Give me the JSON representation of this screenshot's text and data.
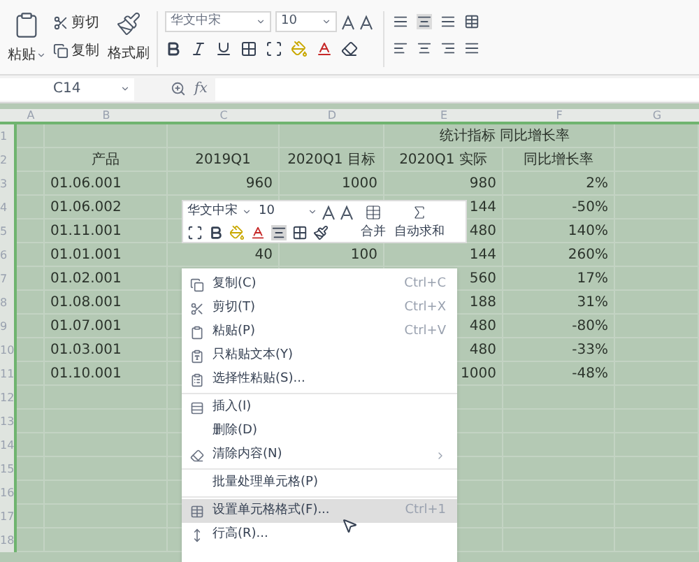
{
  "ribbon": {
    "paste": "粘贴",
    "cut": "剪切",
    "copy": "复制",
    "format_painter": "格式刷",
    "font": {
      "name": "华文中宋",
      "size": "10"
    }
  },
  "formula_bar": {
    "name_box": "C14",
    "function_label": "fx"
  },
  "sheet": {
    "columns": [
      "A",
      "B",
      "C",
      "D",
      "E",
      "F",
      "G"
    ],
    "rows": [
      {
        "number": "1",
        "kind": "title",
        "cells": [
          "",
          "",
          "",
          "",
          "统计指标 同比增长率",
          "",
          ""
        ]
      },
      {
        "number": "2",
        "kind": "header",
        "cells": [
          "",
          "产品",
          "2019Q1",
          "2020Q1 目标",
          "2020Q1 实际",
          "同比增长率",
          ""
        ]
      },
      {
        "number": "3",
        "kind": "data",
        "cells": [
          "",
          "01.06.001",
          "960",
          "1000",
          "980",
          "2%",
          ""
        ]
      },
      {
        "number": "4",
        "kind": "data",
        "cells": [
          "",
          "01.06.002",
          "",
          "",
          "144",
          "-50%",
          ""
        ]
      },
      {
        "number": "5",
        "kind": "data",
        "cells": [
          "",
          "01.11.001",
          "",
          "",
          "480",
          "140%",
          ""
        ]
      },
      {
        "number": "6",
        "kind": "data",
        "cells": [
          "",
          "01.01.001",
          "40",
          "100",
          "144",
          "260%",
          ""
        ]
      },
      {
        "number": "7",
        "kind": "data",
        "cells": [
          "",
          "01.02.001",
          "",
          "",
          "560",
          "17%",
          ""
        ]
      },
      {
        "number": "8",
        "kind": "data",
        "cells": [
          "",
          "01.08.001",
          "",
          "",
          "188",
          "31%",
          ""
        ]
      },
      {
        "number": "9",
        "kind": "data",
        "cells": [
          "",
          "01.07.001",
          "",
          "",
          "480",
          "-80%",
          ""
        ]
      },
      {
        "number": "10",
        "kind": "data",
        "cells": [
          "",
          "01.03.001",
          "",
          "",
          "480",
          "-33%",
          ""
        ]
      },
      {
        "number": "11",
        "kind": "data",
        "cells": [
          "",
          "01.10.001",
          "",
          "",
          "1000",
          "-48%",
          ""
        ]
      },
      {
        "number": "12",
        "kind": "data",
        "cells": []
      },
      {
        "number": "13",
        "kind": "data",
        "cells": []
      },
      {
        "number": "14",
        "kind": "data",
        "cells": []
      },
      {
        "number": "15",
        "kind": "data",
        "cells": []
      },
      {
        "number": "16",
        "kind": "data",
        "cells": []
      },
      {
        "number": "17",
        "kind": "data",
        "cells": []
      },
      {
        "number": "18",
        "kind": "data",
        "cells": []
      }
    ]
  },
  "mini_toolbar": {
    "font": "华文中宋",
    "size": "10",
    "merge": "合并",
    "autosum": "自动求和"
  },
  "context_menu": [
    {
      "kind": "copy",
      "label": "复制(C)",
      "shortcut": "Ctrl+C",
      "submenu": false,
      "selected": false
    },
    {
      "kind": "cut",
      "label": "剪切(T)",
      "shortcut": "Ctrl+X",
      "submenu": false,
      "selected": false
    },
    {
      "kind": "paste",
      "label": "粘贴(P)",
      "shortcut": "Ctrl+V",
      "submenu": false,
      "selected": false
    },
    {
      "kind": "pastetext",
      "label": "只粘贴文本(Y)",
      "submenu": false,
      "selected": false
    },
    {
      "kind": "pastespecial",
      "label": "选择性粘贴(S)...",
      "submenu": false,
      "selected": false
    },
    {
      "kind": "separator"
    },
    {
      "kind": "insert",
      "label": "插入(I)",
      "submenu": false,
      "selected": false
    },
    {
      "kind": "plain",
      "label": "删除(D)",
      "submenu": false,
      "selected": false
    },
    {
      "kind": "clear",
      "label": "清除内容(N)",
      "submenu": true,
      "selected": false
    },
    {
      "kind": "separator"
    },
    {
      "kind": "plain",
      "label": "批量处理单元格(P)",
      "submenu": false,
      "selected": false
    },
    {
      "kind": "separator"
    },
    {
      "kind": "format",
      "label": "设置单元格格式(F)...",
      "shortcut": "Ctrl+1",
      "submenu": false,
      "selected": true
    },
    {
      "kind": "rowheight",
      "label": "行高(R)...",
      "submenu": false,
      "selected": false
    }
  ]
}
